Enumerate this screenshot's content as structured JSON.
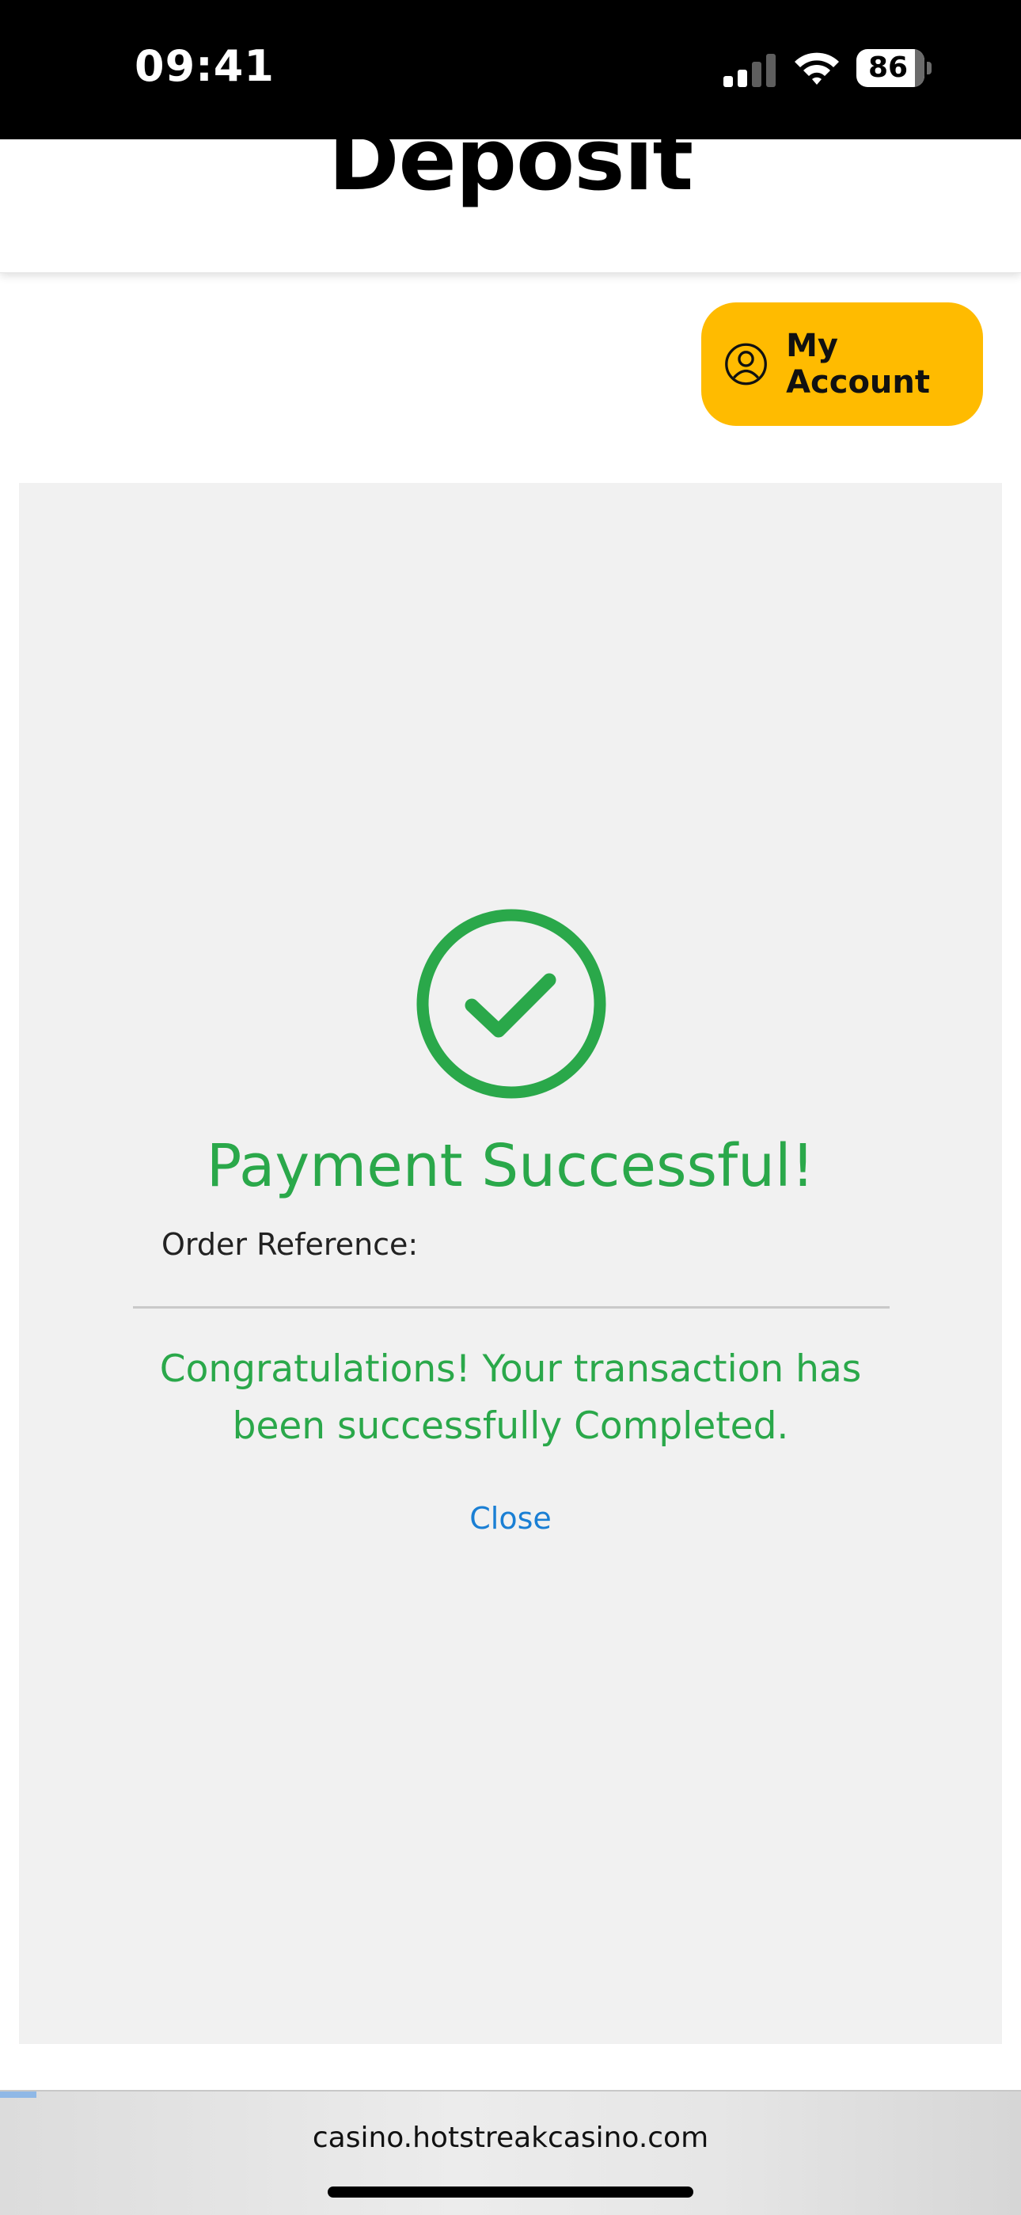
{
  "status_bar": {
    "time": "09:41",
    "battery_level": "86",
    "icons": [
      "signal-icon",
      "wifi-icon",
      "battery-icon"
    ]
  },
  "header": {
    "title": "Deposit"
  },
  "account_button": {
    "label": "My Account",
    "icon": "user-circle-icon",
    "background_color": "#ffbb00"
  },
  "payment": {
    "icon": "check-circle-icon",
    "title": "Payment Successful!",
    "order_reference_label": "Order Reference:",
    "message": "Congratulations! Your transaction has been successfully Completed.",
    "close_label": "Close",
    "success_color": "#2aa84a",
    "link_color": "#1a7fd4"
  },
  "browser": {
    "url": "casino.hotstreakcasino.com"
  }
}
